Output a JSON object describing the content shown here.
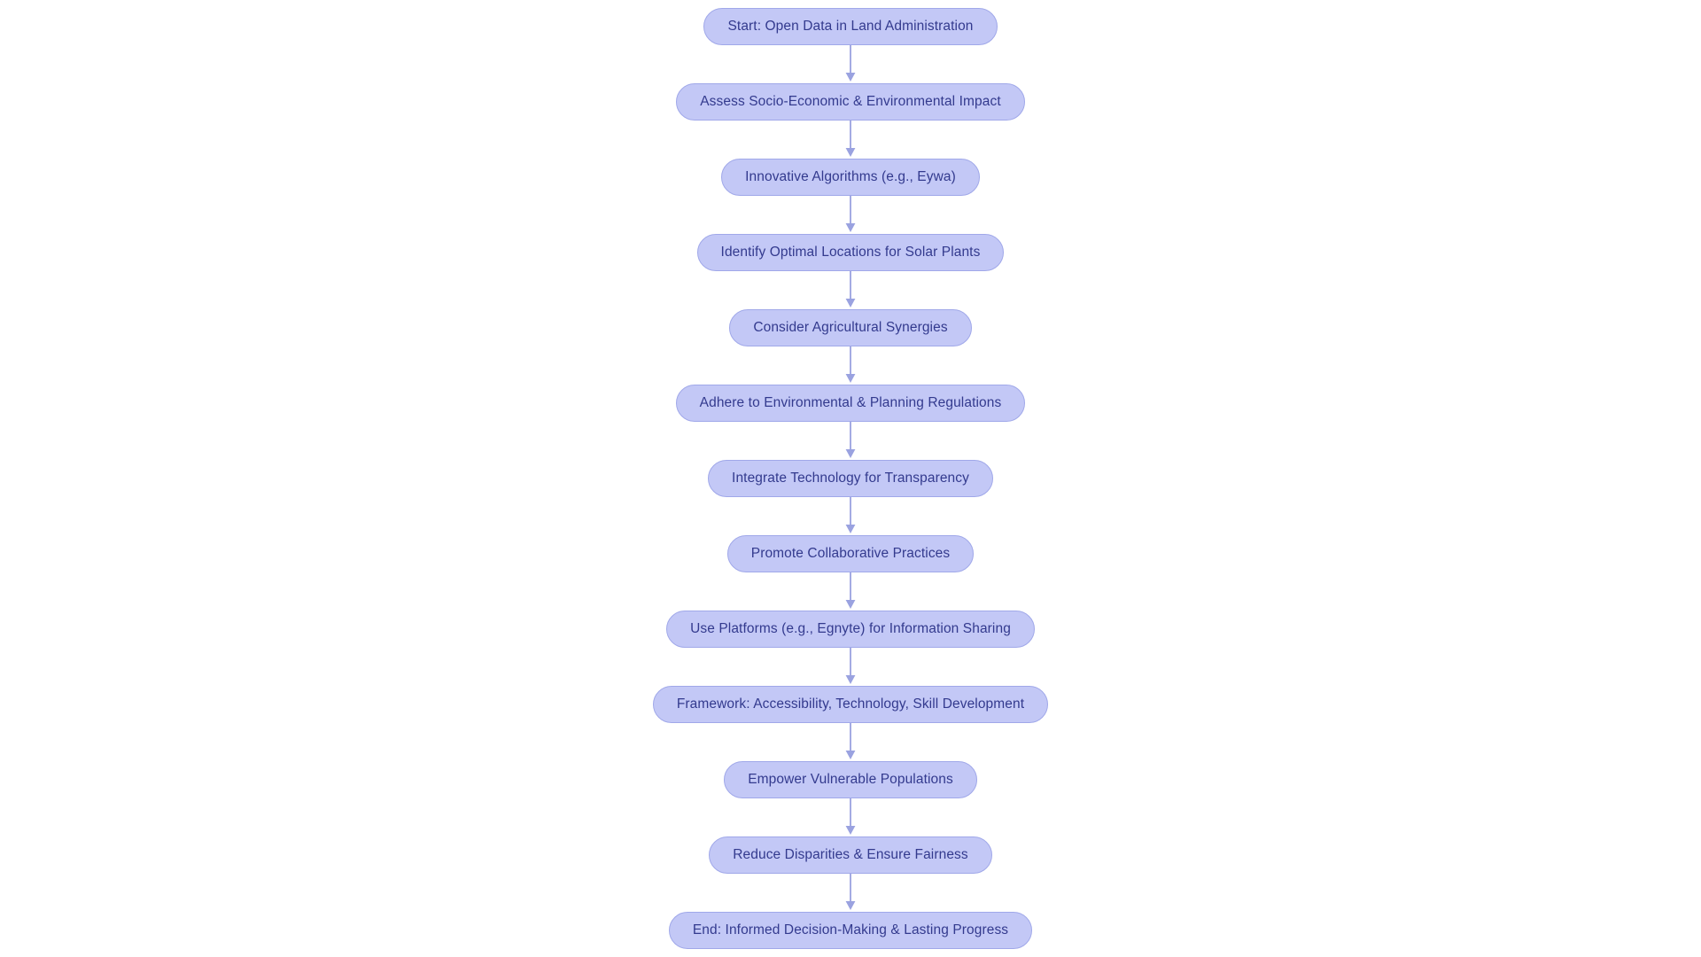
{
  "diagram": {
    "type": "flowchart",
    "orientation": "top-to-bottom",
    "background_color": "#ffffff",
    "node_fill_color": "#c3c8f6",
    "node_border_color": "#a0a8e9",
    "node_text_color": "#333a8e",
    "connector_color": "#9aa2e0",
    "node_count": 13,
    "connector_count": 12,
    "nodes": [
      {
        "id": "start",
        "label": "Start: Open Data in Land Administration"
      },
      {
        "id": "assess",
        "label": "Assess Socio-Economic & Environmental Impact"
      },
      {
        "id": "algorithms",
        "label": "Innovative Algorithms (e.g., Eywa)"
      },
      {
        "id": "locations",
        "label": "Identify Optimal Locations for Solar Plants"
      },
      {
        "id": "synergies",
        "label": "Consider Agricultural Synergies"
      },
      {
        "id": "regulations",
        "label": "Adhere to Environmental & Planning Regulations"
      },
      {
        "id": "transparency",
        "label": "Integrate Technology for Transparency"
      },
      {
        "id": "collaborative",
        "label": "Promote Collaborative Practices"
      },
      {
        "id": "platforms",
        "label": "Use Platforms (e.g., Egnyte) for Information Sharing"
      },
      {
        "id": "framework",
        "label": "Framework: Accessibility, Technology, Skill Development"
      },
      {
        "id": "empower",
        "label": "Empower Vulnerable Populations"
      },
      {
        "id": "fairness",
        "label": "Reduce Disparities & Ensure Fairness"
      },
      {
        "id": "end",
        "label": "End: Informed Decision-Making & Lasting Progress"
      }
    ],
    "edges": [
      {
        "from": "start",
        "to": "assess"
      },
      {
        "from": "assess",
        "to": "algorithms"
      },
      {
        "from": "algorithms",
        "to": "locations"
      },
      {
        "from": "locations",
        "to": "synergies"
      },
      {
        "from": "synergies",
        "to": "regulations"
      },
      {
        "from": "regulations",
        "to": "transparency"
      },
      {
        "from": "transparency",
        "to": "collaborative"
      },
      {
        "from": "collaborative",
        "to": "platforms"
      },
      {
        "from": "platforms",
        "to": "framework"
      },
      {
        "from": "framework",
        "to": "empower"
      },
      {
        "from": "empower",
        "to": "fairness"
      },
      {
        "from": "fairness",
        "to": "end"
      }
    ]
  }
}
